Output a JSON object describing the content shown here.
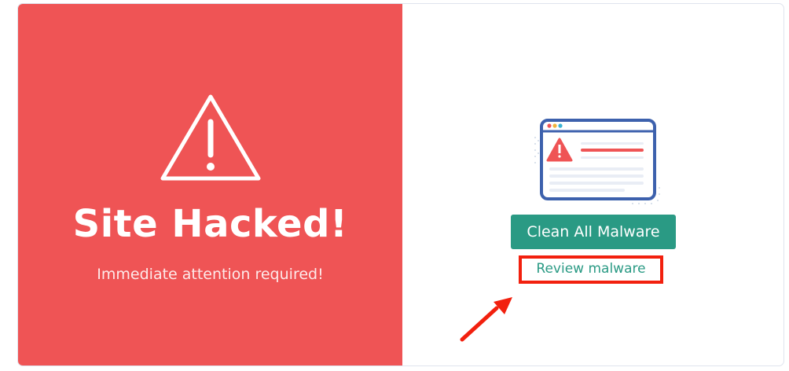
{
  "status_panel": {
    "title": "Site Hacked!",
    "subtitle": "Immediate attention required!",
    "icon": "warning-triangle-icon",
    "background_color": "#ef5455"
  },
  "actions": {
    "illustration_icon": "browser-warning-illustration",
    "clean_button_label": "Clean All Malware",
    "review_link_label": "Review malware",
    "accent_color": "#2a9a84",
    "highlight_color": "#f2200e"
  }
}
